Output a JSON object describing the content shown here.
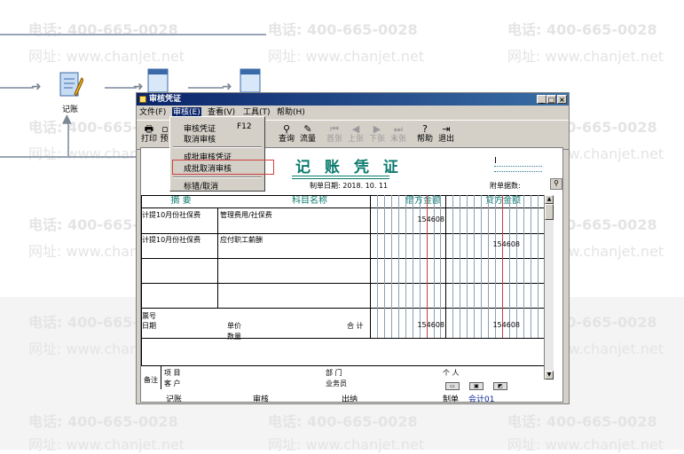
{
  "watermark": {
    "phone": "电话: 400-665-0028",
    "site": "网址: www.chanjet.net"
  },
  "flow": {
    "node_label": "记账"
  },
  "window": {
    "title": "审核凭证",
    "controls": [
      "_",
      "□",
      "×"
    ]
  },
  "menu": [
    {
      "label": "文件(F)"
    },
    {
      "label": "审核(E)"
    },
    {
      "label": "查看(V)"
    },
    {
      "label": "工具(T)"
    },
    {
      "label": "帮助(H)"
    }
  ],
  "toolbar": {
    "print": "打印",
    "preview": "预",
    "query": "查询",
    "flow": "流量",
    "first": "首张",
    "prev": "上张",
    "next": "下张",
    "last": "末张",
    "help": "帮助",
    "exit": "退出",
    "hidden_suffix": "出"
  },
  "dropdown": {
    "items": [
      {
        "label": "审核凭证",
        "shortcut": "F12"
      },
      {
        "label": "取消审核",
        "shortcut": ""
      },
      {
        "label": "成批审核凭证",
        "shortcut": ""
      },
      {
        "label": "成批取消审核",
        "shortcut": ""
      },
      {
        "label": "标错/取消",
        "shortcut": ""
      }
    ]
  },
  "voucher": {
    "title": "记 账 凭 证",
    "date_label": "制单日期: 2018. 10. 11",
    "attachment_label": "附单据数:",
    "columns": {
      "summary": "摘 要",
      "account": "科目名称",
      "debit": "借方金额",
      "credit": "贷方金额"
    },
    "rows": [
      {
        "summary": "计提10月份社保费",
        "account": "管理费用/社保费",
        "debit": "154608",
        "credit": ""
      },
      {
        "summary": "计提10月份社保费",
        "account": "应付职工薪酬",
        "debit": "",
        "credit": "154608"
      }
    ],
    "footer": {
      "ticket_no": "票号",
      "date": "日期",
      "unit_price": "单价",
      "quantity": "数量",
      "total_label": "合 计",
      "total_debit": "154608",
      "total_credit": "154608",
      "remark": "备注",
      "project": "项 目",
      "customer": "客 户",
      "department": "部 门",
      "salesman": "业务员",
      "individual": "个 人"
    },
    "signatures": {
      "bookkeeping": "记账",
      "review": "审核",
      "cashier": "出纳",
      "maker_label": "制单",
      "maker": "会计01"
    }
  }
}
